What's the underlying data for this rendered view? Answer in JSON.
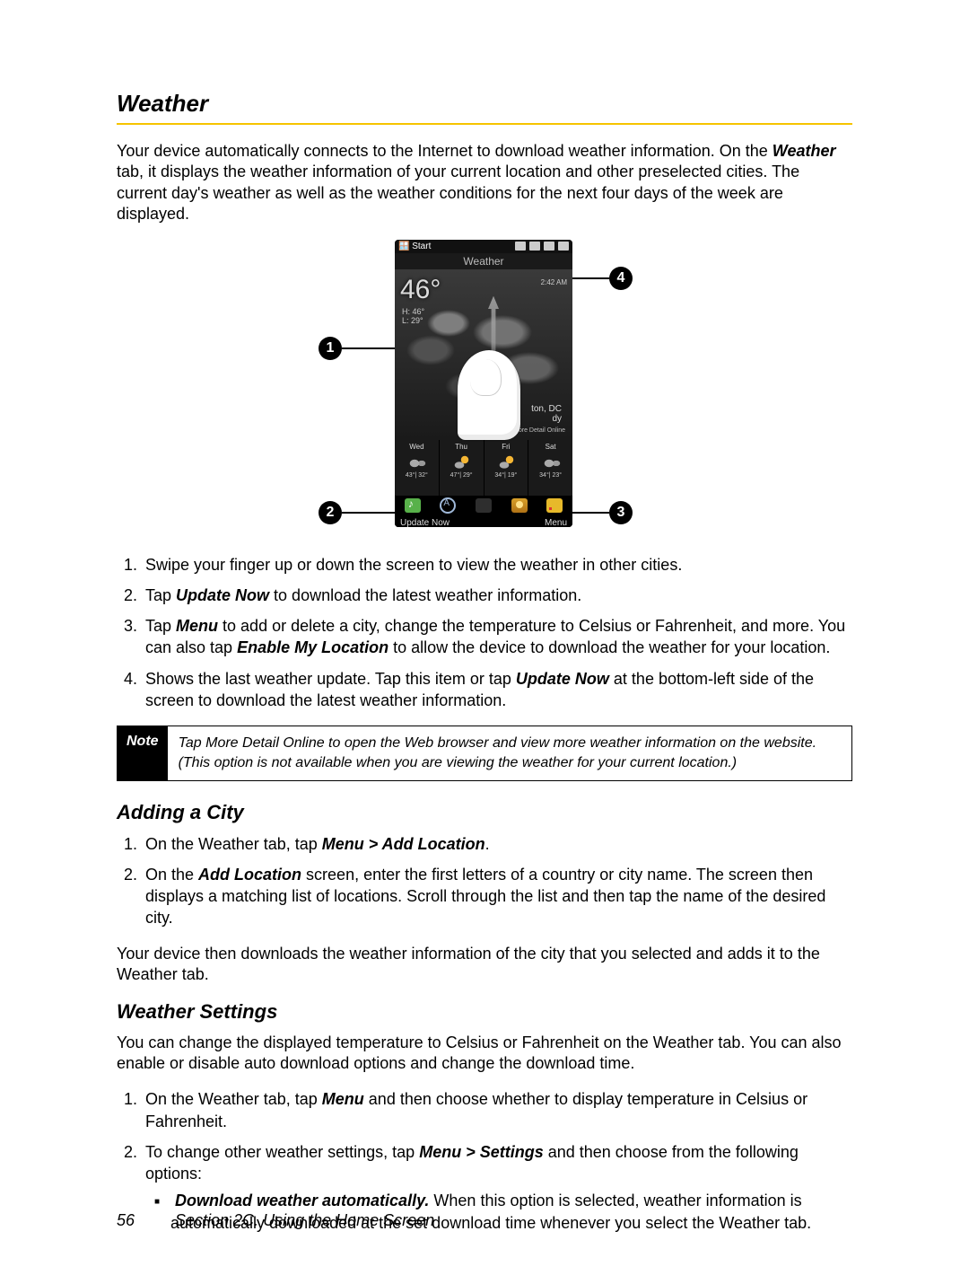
{
  "heading": "Weather",
  "intro_pre": "Your device automatically connects to the Internet to download weather information. On the ",
  "intro_bi": "Weather",
  "intro_post": " tab, it displays the weather information of your current location and other preselected cities. The current day's weather as well as the weather conditions for the next four days of the week are displayed.",
  "phone": {
    "start": "Start",
    "title": "Weather",
    "temp": "46°",
    "hi": "H: 46°",
    "lo": "L: 29°",
    "update_time": "2:42 AM",
    "city": "ton, DC",
    "cond": "dy",
    "more": "More Detail Online",
    "days": [
      {
        "d": "Wed",
        "t": "43°| 32°"
      },
      {
        "d": "Thu",
        "t": "47°| 29°"
      },
      {
        "d": "Fri",
        "t": "34°| 19°"
      },
      {
        "d": "Sat",
        "t": "34°| 23°"
      }
    ],
    "sk_left": "Update Now",
    "sk_right": "Menu"
  },
  "callouts": {
    "c1": "1",
    "c2": "2",
    "c3": "3",
    "c4": "4"
  },
  "list1": {
    "i1": "Swipe your finger up or down the screen to view the weather in other cities.",
    "i2_pre": "Tap ",
    "i2_b": "Update Now",
    "i2_post": " to download the latest weather information.",
    "i3_pre": "Tap ",
    "i3_b1": "Menu",
    "i3_mid": " to add or delete a city, change the temperature to Celsius or Fahrenheit, and more. You can also tap ",
    "i3_b2": "Enable My Location",
    "i3_post": " to allow the device to download the weather for your location.",
    "i4_pre": "Shows the last weather update. Tap this item or tap ",
    "i4_b": "Update Now",
    "i4_post": " at the bottom-left side of the screen to download the latest weather information."
  },
  "note": {
    "tag": "Note",
    "text": "Tap More Detail Online to open the Web browser and view more weather information on the website. (This option is not available when you are viewing the weather for your current location.)"
  },
  "sub1": "Adding a City",
  "list2": {
    "i1_pre": "On the Weather tab, tap ",
    "i1_b": "Menu > Add Location",
    "i1_post": ".",
    "i2_pre": "On the ",
    "i2_b": "Add Location",
    "i2_post": " screen, enter the first letters of a country or city name. The screen then displays a matching list of locations. Scroll through the list and then tap the name of the desired city."
  },
  "after2": "Your device then downloads the weather information of the city that you selected and adds it to the Weather tab.",
  "sub2": "Weather Settings",
  "ws_intro": "You can change the displayed temperature to Celsius or Fahrenheit on the Weather tab. You can also enable or disable auto download options and change the download time.",
  "list3": {
    "i1_pre": "On the Weather tab, tap ",
    "i1_b": "Menu",
    "i1_post": " and then choose whether to display temperature in Celsius or Fahrenheit.",
    "i2_pre": "To change other weather settings, tap ",
    "i2_b": "Menu > Settings",
    "i2_post": " and then choose from the following options:",
    "bul_b": "Download weather automatically.",
    "bul_post": " When this option is selected, weather information is automatically downloaded at the set download time whenever you select the Weather tab."
  },
  "footer": {
    "page": "56",
    "section": "Section 2C. Using the Home Screen"
  }
}
